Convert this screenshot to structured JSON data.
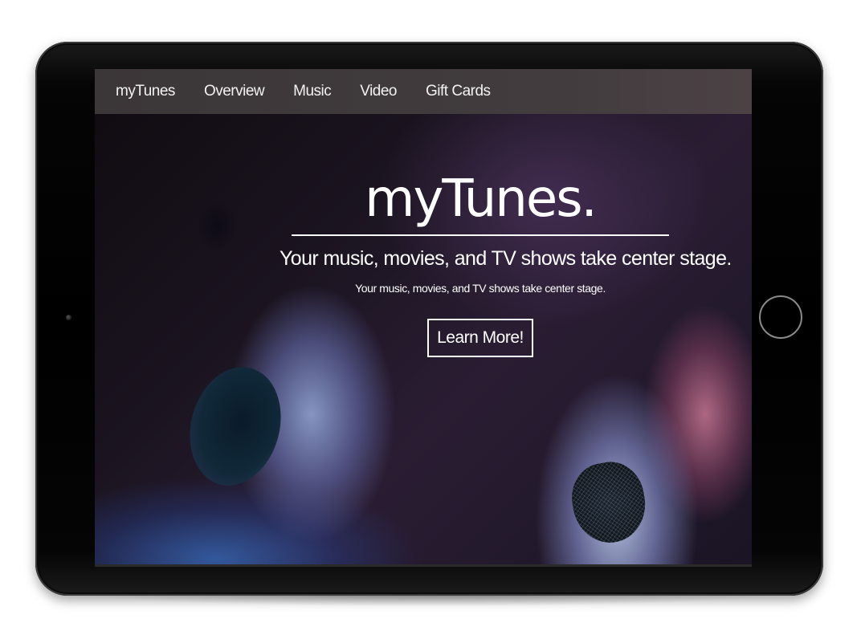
{
  "navbar": {
    "items": [
      {
        "label": "myTunes"
      },
      {
        "label": "Overview"
      },
      {
        "label": "Music"
      },
      {
        "label": "Video"
      },
      {
        "label": "Gift Cards"
      }
    ]
  },
  "hero": {
    "title": "myTunes.",
    "subtitle": "Your music, movies, and TV shows take center stage.",
    "tagline": "Your music, movies, and TV shows take center stage.",
    "cta_label": "Learn More!"
  },
  "colors": {
    "navbar_bg": "#3b3637",
    "text": "#ffffff",
    "device_frame": "#000000"
  },
  "icons": {
    "home_button": "home-button-icon",
    "camera": "camera-icon"
  }
}
